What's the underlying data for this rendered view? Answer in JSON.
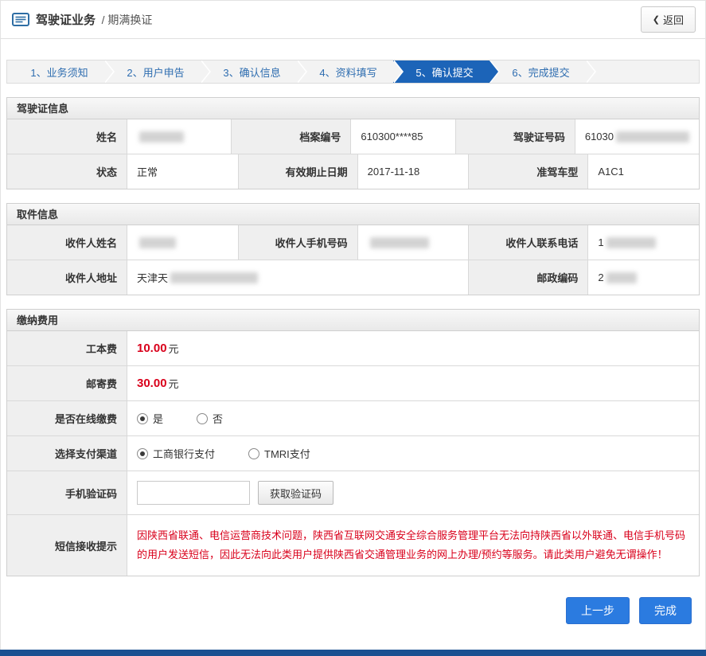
{
  "header": {
    "title_primary": "驾驶证业务",
    "title_secondary": "/ 期满换证",
    "back_chevron": "❮",
    "back_label": "返回"
  },
  "steps": {
    "items": [
      {
        "label": "1、业务须知"
      },
      {
        "label": "2、用户申告"
      },
      {
        "label": "3、确认信息"
      },
      {
        "label": "4、资料填写"
      },
      {
        "label": "5、确认提交"
      },
      {
        "label": "6、完成提交"
      }
    ],
    "active_index": 4
  },
  "license": {
    "title": "驾驶证信息",
    "labels": {
      "name": "姓名",
      "file_no": "档案编号",
      "license_no": "驾驶证号码",
      "status": "状态",
      "expiry": "有效期止日期",
      "vehicle": "准驾车型"
    },
    "values": {
      "name_masked": "",
      "file_no": "610300****85",
      "license_no_prefix": "61030",
      "status": "正常",
      "expiry": "2017-11-18",
      "vehicle": "A1C1"
    }
  },
  "pickup": {
    "title": "取件信息",
    "labels": {
      "name": "收件人姓名",
      "mobile": "收件人手机号码",
      "phone": "收件人联系电话",
      "address": "收件人地址",
      "postcode": "邮政编码"
    },
    "values": {
      "name_masked": "",
      "mobile_masked": "",
      "phone_prefix": "1",
      "address_prefix": "天津天",
      "postcode_prefix": "2"
    }
  },
  "fees": {
    "title": "缴纳费用",
    "base_fee_label": "工本费",
    "base_fee_amount": "10.00",
    "base_fee_unit": "元",
    "mail_fee_label": "邮寄费",
    "mail_fee_amount": "30.00",
    "mail_fee_unit": "元",
    "online_label": "是否在线缴费",
    "online_yes": "是",
    "online_no": "否",
    "channel_label": "选择支付渠道",
    "channel_icbc": "工商银行支付",
    "channel_tmri": "TMRI支付",
    "code_label": "手机验证码",
    "code_button": "获取验证码",
    "notice_label": "短信接收提示",
    "notice_text": "因陕西省联通、电信运营商技术问题，陕西省互联网交通安全综合服务管理平台无法向持陕西省以外联通、电信手机号码的用户发送短信，因此无法向此类用户提供陕西省交通管理业务的网上办理/预约等服务。请此类用户避免无谓操作！"
  },
  "actions": {
    "prev": "上一步",
    "finish": "完成"
  },
  "colors": {
    "accent_blue": "#1c64b8",
    "button_blue": "#2b7be0",
    "alert_red": "#d9001b"
  }
}
